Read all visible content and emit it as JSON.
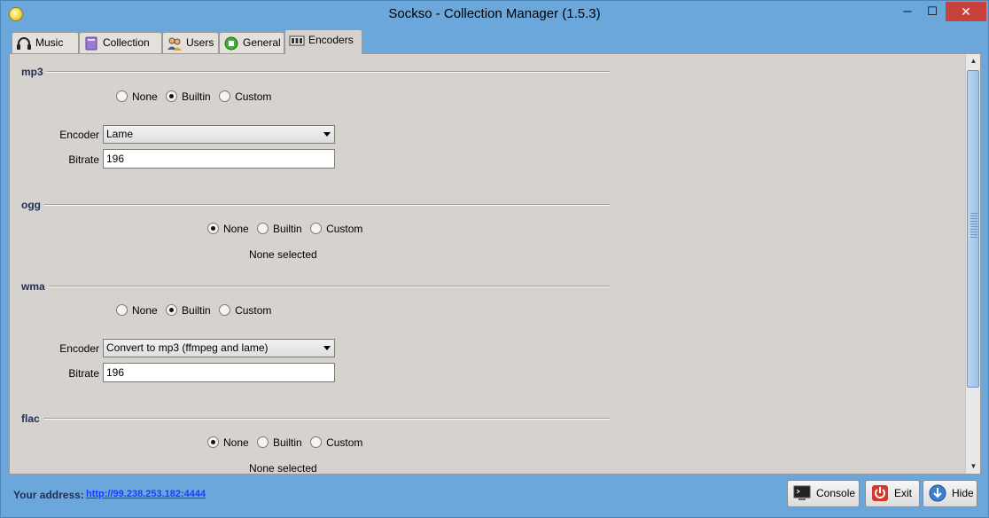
{
  "window": {
    "title": "Sockso - Collection Manager (1.5.3)",
    "min": "─",
    "max": "☐",
    "close": "✕"
  },
  "tabs": [
    {
      "label": "Music",
      "icon": "headphones-icon"
    },
    {
      "label": "Collection",
      "icon": "collection-icon"
    },
    {
      "label": "Users",
      "icon": "users-icon"
    },
    {
      "label": "General",
      "icon": "general-icon"
    },
    {
      "label": "Encoders",
      "icon": "encoders-icon",
      "active": true
    }
  ],
  "encoders": {
    "options": {
      "none": "None",
      "builtin": "Builtin",
      "custom": "Custom"
    },
    "encoder_label": "Encoder",
    "bitrate_label": "Bitrate",
    "none_selected": "None selected",
    "mp3": {
      "title": "mp3",
      "selected": "builtin",
      "encoder": "Lame",
      "bitrate": "196"
    },
    "ogg": {
      "title": "ogg",
      "selected": "none"
    },
    "wma": {
      "title": "wma",
      "selected": "builtin",
      "encoder": "Convert to mp3 (ffmpeg and lame)",
      "bitrate": "196"
    },
    "flac": {
      "title": "flac",
      "selected": "none"
    }
  },
  "footer": {
    "address_label": "Your address:",
    "address_url": "http://99.238.253.182:4444",
    "console": "Console",
    "exit": "Exit",
    "hide": "Hide"
  },
  "colors": {
    "accent": "#6ba7da",
    "panel": "#d6d3ce",
    "section_title": "#1f2f55",
    "link": "#1a3cff"
  }
}
